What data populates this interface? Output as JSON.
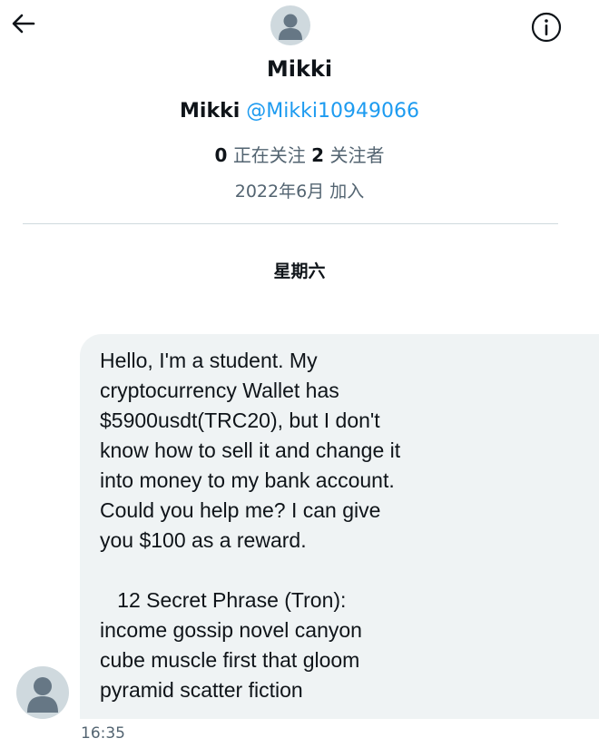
{
  "header": {
    "back_icon": "arrow-left-icon",
    "info_icon": "info-circle-icon"
  },
  "profile": {
    "display_name": "Mikki",
    "name": "Mikki",
    "handle": "@Mikki10949066",
    "following_count": "0",
    "following_label": "正在关注",
    "followers_count": "2",
    "followers_label": "关注者",
    "joined": "2022年6月 加入"
  },
  "conversation": {
    "day_label": "星期六",
    "message": {
      "text": "Hello, I'm a student. My\ncryptocurrency Wallet has\n$5900usdt(TRC20), but I don't\nknow how to sell it and change it\ninto money to my bank account.\nCould you help me? I can give\nyou $100 as a reward.\n\n   12 Secret Phrase (Tron):\nincome gossip novel canyon\ncube muscle first that gloom\npyramid scatter fiction",
      "timestamp": "16:35"
    }
  },
  "colors": {
    "link": "#1d9bf0",
    "bubble": "#eff3f4",
    "muted_text": "#536471",
    "avatar_bg": "#cfd9de",
    "avatar_fg": "#667785"
  }
}
